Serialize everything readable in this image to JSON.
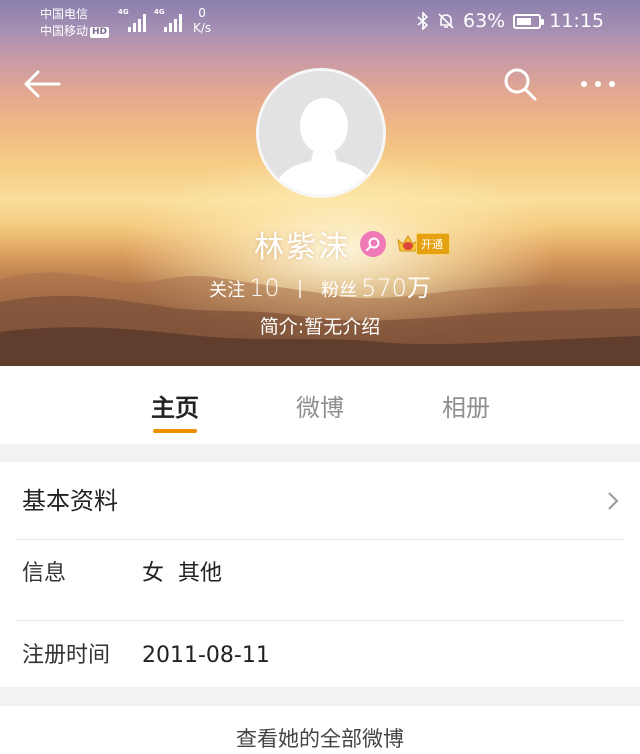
{
  "status_bar": {
    "carrier1": "中国电信",
    "carrier2": "中国移动",
    "hd": "HD",
    "net1": "4G",
    "net2": "4G",
    "speed_value": "0",
    "speed_unit": "K/s",
    "battery": "63%",
    "time": "11:15",
    "icons": [
      "bluetooth-icon",
      "mute-icon",
      "battery-icon"
    ]
  },
  "header": {
    "back_icon": "back-arrow-icon",
    "search_icon": "search-icon",
    "more_icon": "more-icon"
  },
  "profile": {
    "name": "林紫沫",
    "vip_badge_icon": "vip-magnifier-icon",
    "open_badge": "开通",
    "following_label": "关注",
    "following_count": "10",
    "followers_label": "粉丝",
    "followers_count": "570万",
    "intro": "简介:暂无介绍"
  },
  "tabs": [
    {
      "label": "主页",
      "active": true
    },
    {
      "label": "微博",
      "active": false
    },
    {
      "label": "相册",
      "active": false
    }
  ],
  "info": {
    "section_title": "基本资料",
    "rows": [
      {
        "label": "信息",
        "value": "女  其他"
      },
      {
        "label": "注册时间",
        "value": "2011-08-11"
      }
    ]
  },
  "footer": {
    "link": "查看她的全部微博"
  },
  "colors": {
    "accent": "#f09000",
    "vip_pink": "#f07ab7",
    "badge_gold": "#e5a112"
  }
}
